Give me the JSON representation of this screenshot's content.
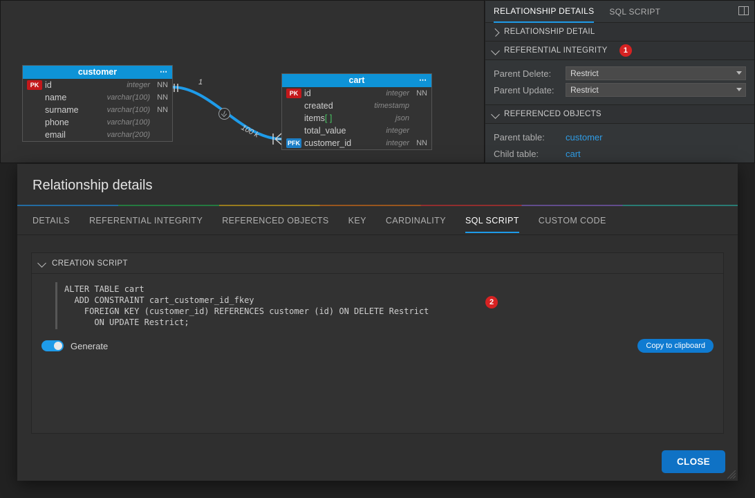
{
  "canvas": {
    "entities": [
      {
        "name": "customer",
        "cols": [
          {
            "key": "PK",
            "name": "id",
            "type": "integer",
            "nn": "NN"
          },
          {
            "key": "",
            "name": "name",
            "type": "varchar(100)",
            "nn": "NN"
          },
          {
            "key": "",
            "name": "surname",
            "type": "varchar(100)",
            "nn": "NN"
          },
          {
            "key": "",
            "name": "phone",
            "type": "varchar(100)",
            "nn": ""
          },
          {
            "key": "",
            "name": "email",
            "type": "varchar(200)",
            "nn": ""
          }
        ]
      },
      {
        "name": "cart",
        "cols": [
          {
            "key": "PK",
            "name": "id",
            "type": "integer",
            "nn": "NN"
          },
          {
            "key": "",
            "name": "created",
            "type": "timestamp",
            "nn": ""
          },
          {
            "key": "ARR",
            "name": "items",
            "type": "json",
            "nn": ""
          },
          {
            "key": "",
            "name": "total_value",
            "type": "integer",
            "nn": ""
          },
          {
            "key": "PFK",
            "name": "customer_id",
            "type": "integer",
            "nn": "NN"
          }
        ]
      }
    ],
    "relation": {
      "leftLabel": "1",
      "rightLabel": "100 k"
    }
  },
  "side": {
    "tabs": {
      "details": "RELATIONSHIP DETAILS",
      "sql": "SQL SCRIPT"
    },
    "sections": {
      "detail": "RELATIONSHIP DETAIL",
      "refint": "REFERENTIAL INTEGRITY",
      "refobj": "REFERENCED OBJECTS"
    },
    "refint": {
      "pdel_label": "Parent Delete:",
      "pdel_value": "Restrict",
      "pupd_label": "Parent Update:",
      "pupd_value": "Restrict"
    },
    "refobj": {
      "ptable_label": "Parent table:",
      "ptable_value": "customer",
      "ctable_label": "Child table:",
      "ctable_value": "cart"
    },
    "annotation": "1"
  },
  "modal": {
    "title": "Relationship details",
    "tabs": {
      "details": "DETAILS",
      "refint": "REFERENTIAL INTEGRITY",
      "refobj": "REFERENCED OBJECTS",
      "key": "KEY",
      "card": "CARDINALITY",
      "sql": "SQL SCRIPT",
      "custom": "CUSTOM CODE"
    },
    "script_head": "CREATION SCRIPT",
    "script": "ALTER TABLE cart\n  ADD CONSTRAINT cart_customer_id_fkey\n    FOREIGN KEY (customer_id) REFERENCES customer (id) ON DELETE Restrict\n      ON UPDATE Restrict;",
    "generate": "Generate",
    "copy": "Copy to clipboard",
    "close": "CLOSE",
    "annotation": "2"
  }
}
